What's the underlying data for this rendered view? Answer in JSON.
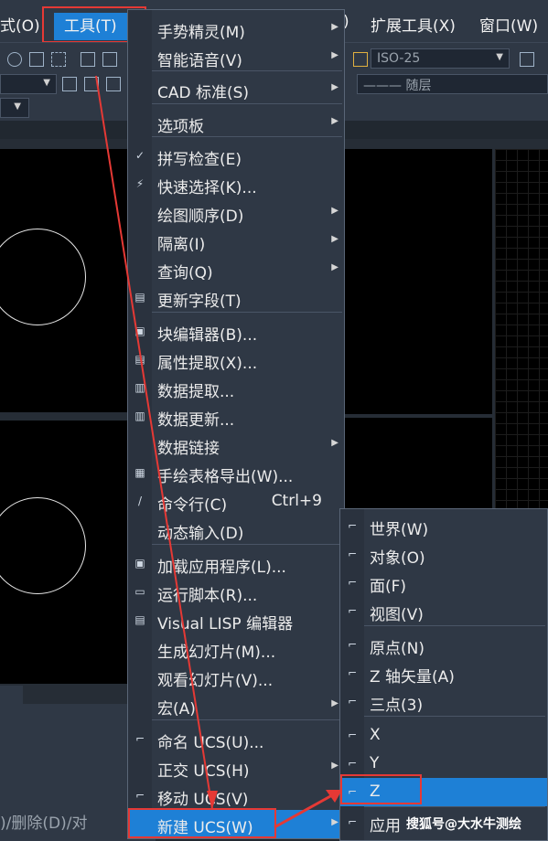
{
  "menubar": {
    "items": [
      {
        "label": "式(O)"
      },
      {
        "label": "工具(T)"
      },
      {
        "label": ")"
      },
      {
        "label": "扩展工具(X)"
      },
      {
        "label": "窗口(W)"
      }
    ]
  },
  "toolbar": {
    "dimstyle_value": "ISO-25",
    "linetype_value": "——— 随层"
  },
  "cmdline": {
    "text": ")/删除(D)/对"
  },
  "tools_menu": {
    "items": [
      {
        "label": "手势精灵(M)",
        "icon": "",
        "submenu": true
      },
      {
        "label": "智能语音(V)",
        "icon": "",
        "submenu": true
      },
      {
        "label": "CAD 标准(S)",
        "icon": "",
        "submenu": true
      },
      {
        "label": "选项板",
        "icon": "",
        "submenu": true
      },
      {
        "label": "拼写检查(E)",
        "icon": "spellcheck-icon",
        "submenu": false
      },
      {
        "label": "快速选择(K)...",
        "icon": "quick-select-icon",
        "submenu": false
      },
      {
        "label": "绘图顺序(D)",
        "icon": "",
        "submenu": true
      },
      {
        "label": "隔离(I)",
        "icon": "",
        "submenu": true
      },
      {
        "label": "查询(Q)",
        "icon": "",
        "submenu": true
      },
      {
        "label": "更新字段(T)",
        "icon": "update-field-icon",
        "submenu": false
      },
      {
        "label": "块编辑器(B)...",
        "icon": "block-editor-icon",
        "submenu": false
      },
      {
        "label": "属性提取(X)...",
        "icon": "attribute-extract-icon",
        "submenu": false
      },
      {
        "label": "数据提取...",
        "icon": "data-extract-icon",
        "submenu": false
      },
      {
        "label": "数据更新...",
        "icon": "data-update-icon",
        "submenu": false
      },
      {
        "label": "数据链接",
        "icon": "",
        "submenu": true
      },
      {
        "label": "手绘表格导出(W)...",
        "icon": "table-export-icon",
        "submenu": false
      },
      {
        "label": "命令行(C)",
        "icon": "command-line-icon",
        "submenu": false,
        "shortcut": "Ctrl+9"
      },
      {
        "label": "动态输入(D)",
        "icon": "",
        "submenu": false
      },
      {
        "label": "加载应用程序(L)...",
        "icon": "load-app-icon",
        "submenu": false
      },
      {
        "label": "运行脚本(R)...",
        "icon": "run-script-icon",
        "submenu": false
      },
      {
        "label": "Visual LISP 编辑器",
        "icon": "lisp-editor-icon",
        "submenu": false
      },
      {
        "label": "生成幻灯片(M)...",
        "icon": "",
        "submenu": false
      },
      {
        "label": "观看幻灯片(V)...",
        "icon": "",
        "submenu": false
      },
      {
        "label": "宏(A)",
        "icon": "",
        "submenu": true
      },
      {
        "label": "命名 UCS(U)...",
        "icon": "named-ucs-icon",
        "submenu": false
      },
      {
        "label": "正交 UCS(H)",
        "icon": "",
        "submenu": true
      },
      {
        "label": "移动 UCS(V)",
        "icon": "move-ucs-icon",
        "submenu": false
      },
      {
        "label": "新建 UCS(W)",
        "icon": "",
        "submenu": true
      }
    ]
  },
  "ucs_submenu": {
    "items": [
      {
        "label": "世界(W)"
      },
      {
        "label": "对象(O)"
      },
      {
        "label": "面(F)"
      },
      {
        "label": "视图(V)"
      },
      {
        "label": "原点(N)"
      },
      {
        "label": "Z 轴矢量(A)"
      },
      {
        "label": "三点(3)"
      },
      {
        "label": "X"
      },
      {
        "label": "Y"
      },
      {
        "label": "Z"
      },
      {
        "label": "应用"
      }
    ]
  },
  "watermark": {
    "text": "搜狐号@大水牛测绘"
  },
  "colors": {
    "highlight": "#1e80d6",
    "annotation": "#e53935",
    "menu_bg": "#2f3845"
  }
}
